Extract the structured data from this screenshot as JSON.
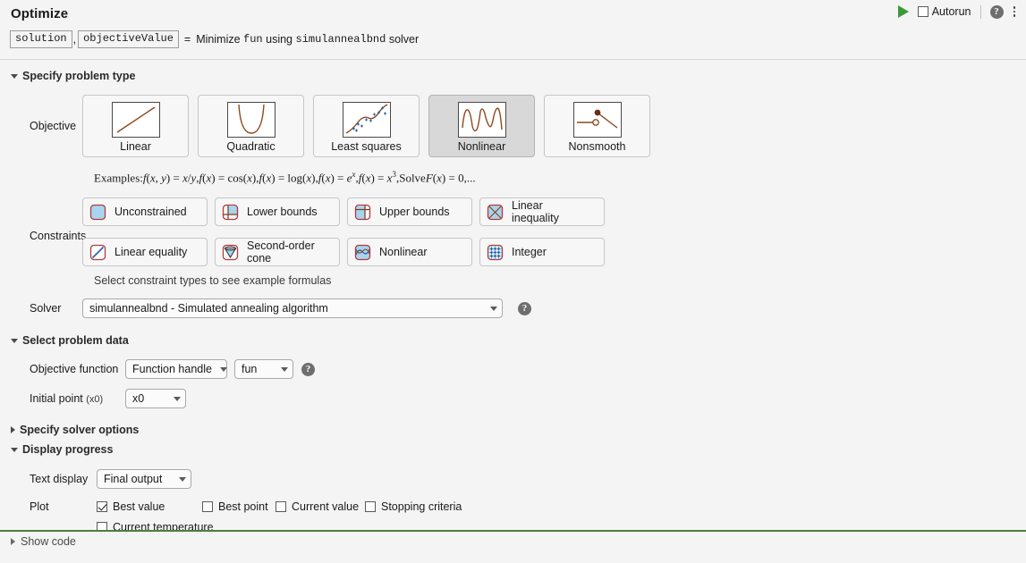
{
  "header": {
    "title": "Optimize",
    "output_var_1": "solution",
    "output_var_2": "objectiveValue",
    "comma": ",",
    "equals": "=",
    "summary_prefix": "Minimize",
    "summary_fun": "fun",
    "summary_middle": "using",
    "summary_solver": "simulannealbnd",
    "summary_suffix": "solver",
    "run_label": "run-icon",
    "autorun_label": "Autorun",
    "autorun_checked": false,
    "help_label": "?",
    "menu_label": "more-options"
  },
  "sections": {
    "problem_type": {
      "label": "Specify problem type",
      "expanded": true
    },
    "problem_data": {
      "label": "Select problem data",
      "expanded": true
    },
    "solver_options": {
      "label": "Specify solver options",
      "expanded": false
    },
    "display_progress": {
      "label": "Display progress",
      "expanded": true
    }
  },
  "objective": {
    "label": "Objective",
    "selected": "Nonlinear",
    "options": [
      {
        "label": "Linear",
        "icon": "linear-plot-icon",
        "selected": false
      },
      {
        "label": "Quadratic",
        "icon": "quadratic-plot-icon",
        "selected": false
      },
      {
        "label": "Least squares",
        "icon": "least-squares-plot-icon",
        "selected": false
      },
      {
        "label": "Nonlinear",
        "icon": "nonlinear-plot-icon",
        "selected": true
      },
      {
        "label": "Nonsmooth",
        "icon": "nonsmooth-plot-icon",
        "selected": false
      }
    ],
    "examples_label": "Examples:",
    "examples_text": "f(x, y) = x/y, f(x) = cos(x), f(x) = log(x), f(x) = e^x, f(x) = x^3, Solve F(x) = 0,..."
  },
  "constraints": {
    "label": "Constraints",
    "hint": "Select constraint types to see example formulas",
    "row1": [
      {
        "label": "Unconstrained",
        "icon": "unconstrained-square-icon"
      },
      {
        "label": "Lower bounds",
        "icon": "lower-bounds-icon"
      },
      {
        "label": "Upper bounds",
        "icon": "upper-bounds-icon"
      },
      {
        "label": "Linear inequality",
        "icon": "linear-inequality-icon"
      }
    ],
    "row2": [
      {
        "label": "Linear equality",
        "icon": "linear-equality-icon"
      },
      {
        "label": "Second-order cone",
        "icon": "second-order-cone-icon"
      },
      {
        "label": "Nonlinear",
        "icon": "nonlinear-constraint-icon"
      },
      {
        "label": "Integer",
        "icon": "integer-grid-icon"
      }
    ]
  },
  "solver": {
    "label": "Solver",
    "value": "simulannealbnd - Simulated annealing algorithm",
    "help_label": "?"
  },
  "problem_data": {
    "objective_function_label": "Objective function",
    "objective_function_type": "Function handle",
    "objective_function_value": "fun",
    "objective_help_label": "?",
    "initial_point_label": "Initial point",
    "initial_point_sub": "(x0)",
    "initial_point_value": "x0"
  },
  "display_progress": {
    "text_display_label": "Text display",
    "text_display_value": "Final output",
    "plot_label": "Plot",
    "plot_options_row1": [
      {
        "label": "Best value",
        "checked": true
      },
      {
        "label": "Best point",
        "checked": false
      },
      {
        "label": "Current value",
        "checked": false
      },
      {
        "label": "Stopping criteria",
        "checked": false
      }
    ],
    "plot_options_row2": [
      {
        "label": "Current temperature",
        "checked": false
      }
    ]
  },
  "footer": {
    "show_code_label": "Show code"
  },
  "colors": {
    "accent_green": "#4d7d3e",
    "icon_brown": "#8c4a20",
    "icon_blue": "#a8d4ee",
    "icon_red": "#b23b3b",
    "marker_blue": "#2a5fa8",
    "background": "#f4f4f4",
    "selected_tile": "#d8d8d8"
  }
}
